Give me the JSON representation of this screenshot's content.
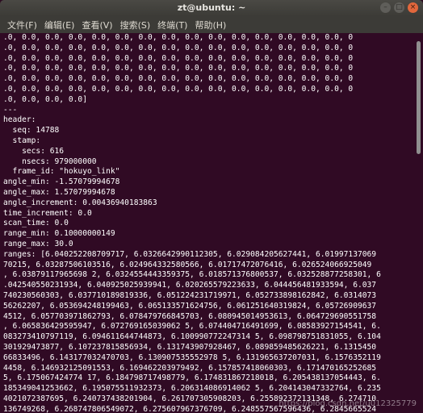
{
  "window": {
    "title": "zt@ubuntu: ~",
    "buttons": {
      "minimize": "–",
      "maximize": "□",
      "close": "×"
    }
  },
  "menubar": {
    "items": [
      "文件(F)",
      "编辑(E)",
      "查看(V)",
      "搜索(S)",
      "终端(T)",
      "帮助(H)"
    ]
  },
  "terminal": {
    "lines": [
      ".0, 0.0, 0.0, 0.0, 0.0, 0.0, 0.0, 0.0, 0.0, 0.0, 0.0, 0.0, 0.0, 0.0, 0.0, 0",
      ".0, 0.0, 0.0, 0.0, 0.0, 0.0, 0.0, 0.0, 0.0, 0.0, 0.0, 0.0, 0.0, 0.0, 0.0, 0",
      ".0, 0.0, 0.0, 0.0, 0.0, 0.0, 0.0, 0.0, 0.0, 0.0, 0.0, 0.0, 0.0, 0.0, 0.0, 0",
      ".0, 0.0, 0.0, 0.0, 0.0, 0.0, 0.0, 0.0, 0.0, 0.0, 0.0, 0.0, 0.0, 0.0, 0.0, 0",
      ".0, 0.0, 0.0, 0.0, 0.0, 0.0, 0.0, 0.0, 0.0, 0.0, 0.0, 0.0, 0.0, 0.0, 0.0, 0",
      ".0, 0.0, 0.0, 0.0, 0.0, 0.0, 0.0, 0.0, 0.0, 0.0, 0.0, 0.0, 0.0, 0.0, 0.0, 0",
      ".0, 0.0, 0.0, 0.0]",
      "---",
      "header:",
      "  seq: 14788",
      "  stamp:",
      "    secs: 616",
      "    nsecs: 979000000",
      "  frame_id: \"hokuyo_link\"",
      "angle_min: -1.57079994678",
      "angle_max: 1.57079994678",
      "angle_increment: 0.00436940183863",
      "time_increment: 0.0",
      "scan_time: 0.0",
      "range_min: 0.10000000149",
      "range_max: 30.0",
      "ranges: [6.040252208709717, 6.0326642990112305, 6.029084205627441, 6.01997137069",
      "70215, 6.03287506103516, 6.024964332580566, 6.01717472076416, 6.026524066925049",
      ", 6.03879117965698 2, 6.0324554443359375, 6.018571376800537, 6.032528877258301, 6",
      ".042540550231934, 6.040925025939941, 6.020265579223633, 6.044456481933594, 6.037",
      "740230560303, 6.037710189819336, 6.051224231719971, 6.052733898162842, 6.0314073",
      "56262207, 6.053694248199463, 6.065133571624756, 6.061251640319824, 6.05726909637",
      "4512, 6.057703971862793, 6.078479766845703, 6.080945014953613, 6.064729690551758",
      ", 6.065836429595947, 6.072769165039062 5, 6.074404716491699, 6.08583927154541, 6.",
      "083273410797119, 6.094611644744873, 6.100990772247314 5, 6.098798751831055, 6.104",
      "301929473877, 6.107237815856934, 6.131743907928467, 6.089859485626221, 6.1315450",
      "66833496, 6.143177032470703, 6.130907535552978 5, 6.131965637207031, 6.1576352119",
      "4458, 6.146932125091553, 6.169462203979492, 6.157857418060303, 6.171470165252685",
      "5, 6.175067424774 17, 6.184798717498779, 6.174831867218018, 6.205438137054443, 6.",
      "185349041253662, 6.195075511932373, 6.206314086914062 5, 6.204143047332764, 6.235",
      "4021072387695, 6.240737438201904, 6.261707305908203, 6.255892372131348, 6.274710",
      "136749268, 6.268747806549072, 6.275607967376709, 6.248557567596436, 6.2845665524"
    ],
    "scroll_position": 0.02,
    "watermark": "https://blog.csdn.net/u012325779"
  }
}
